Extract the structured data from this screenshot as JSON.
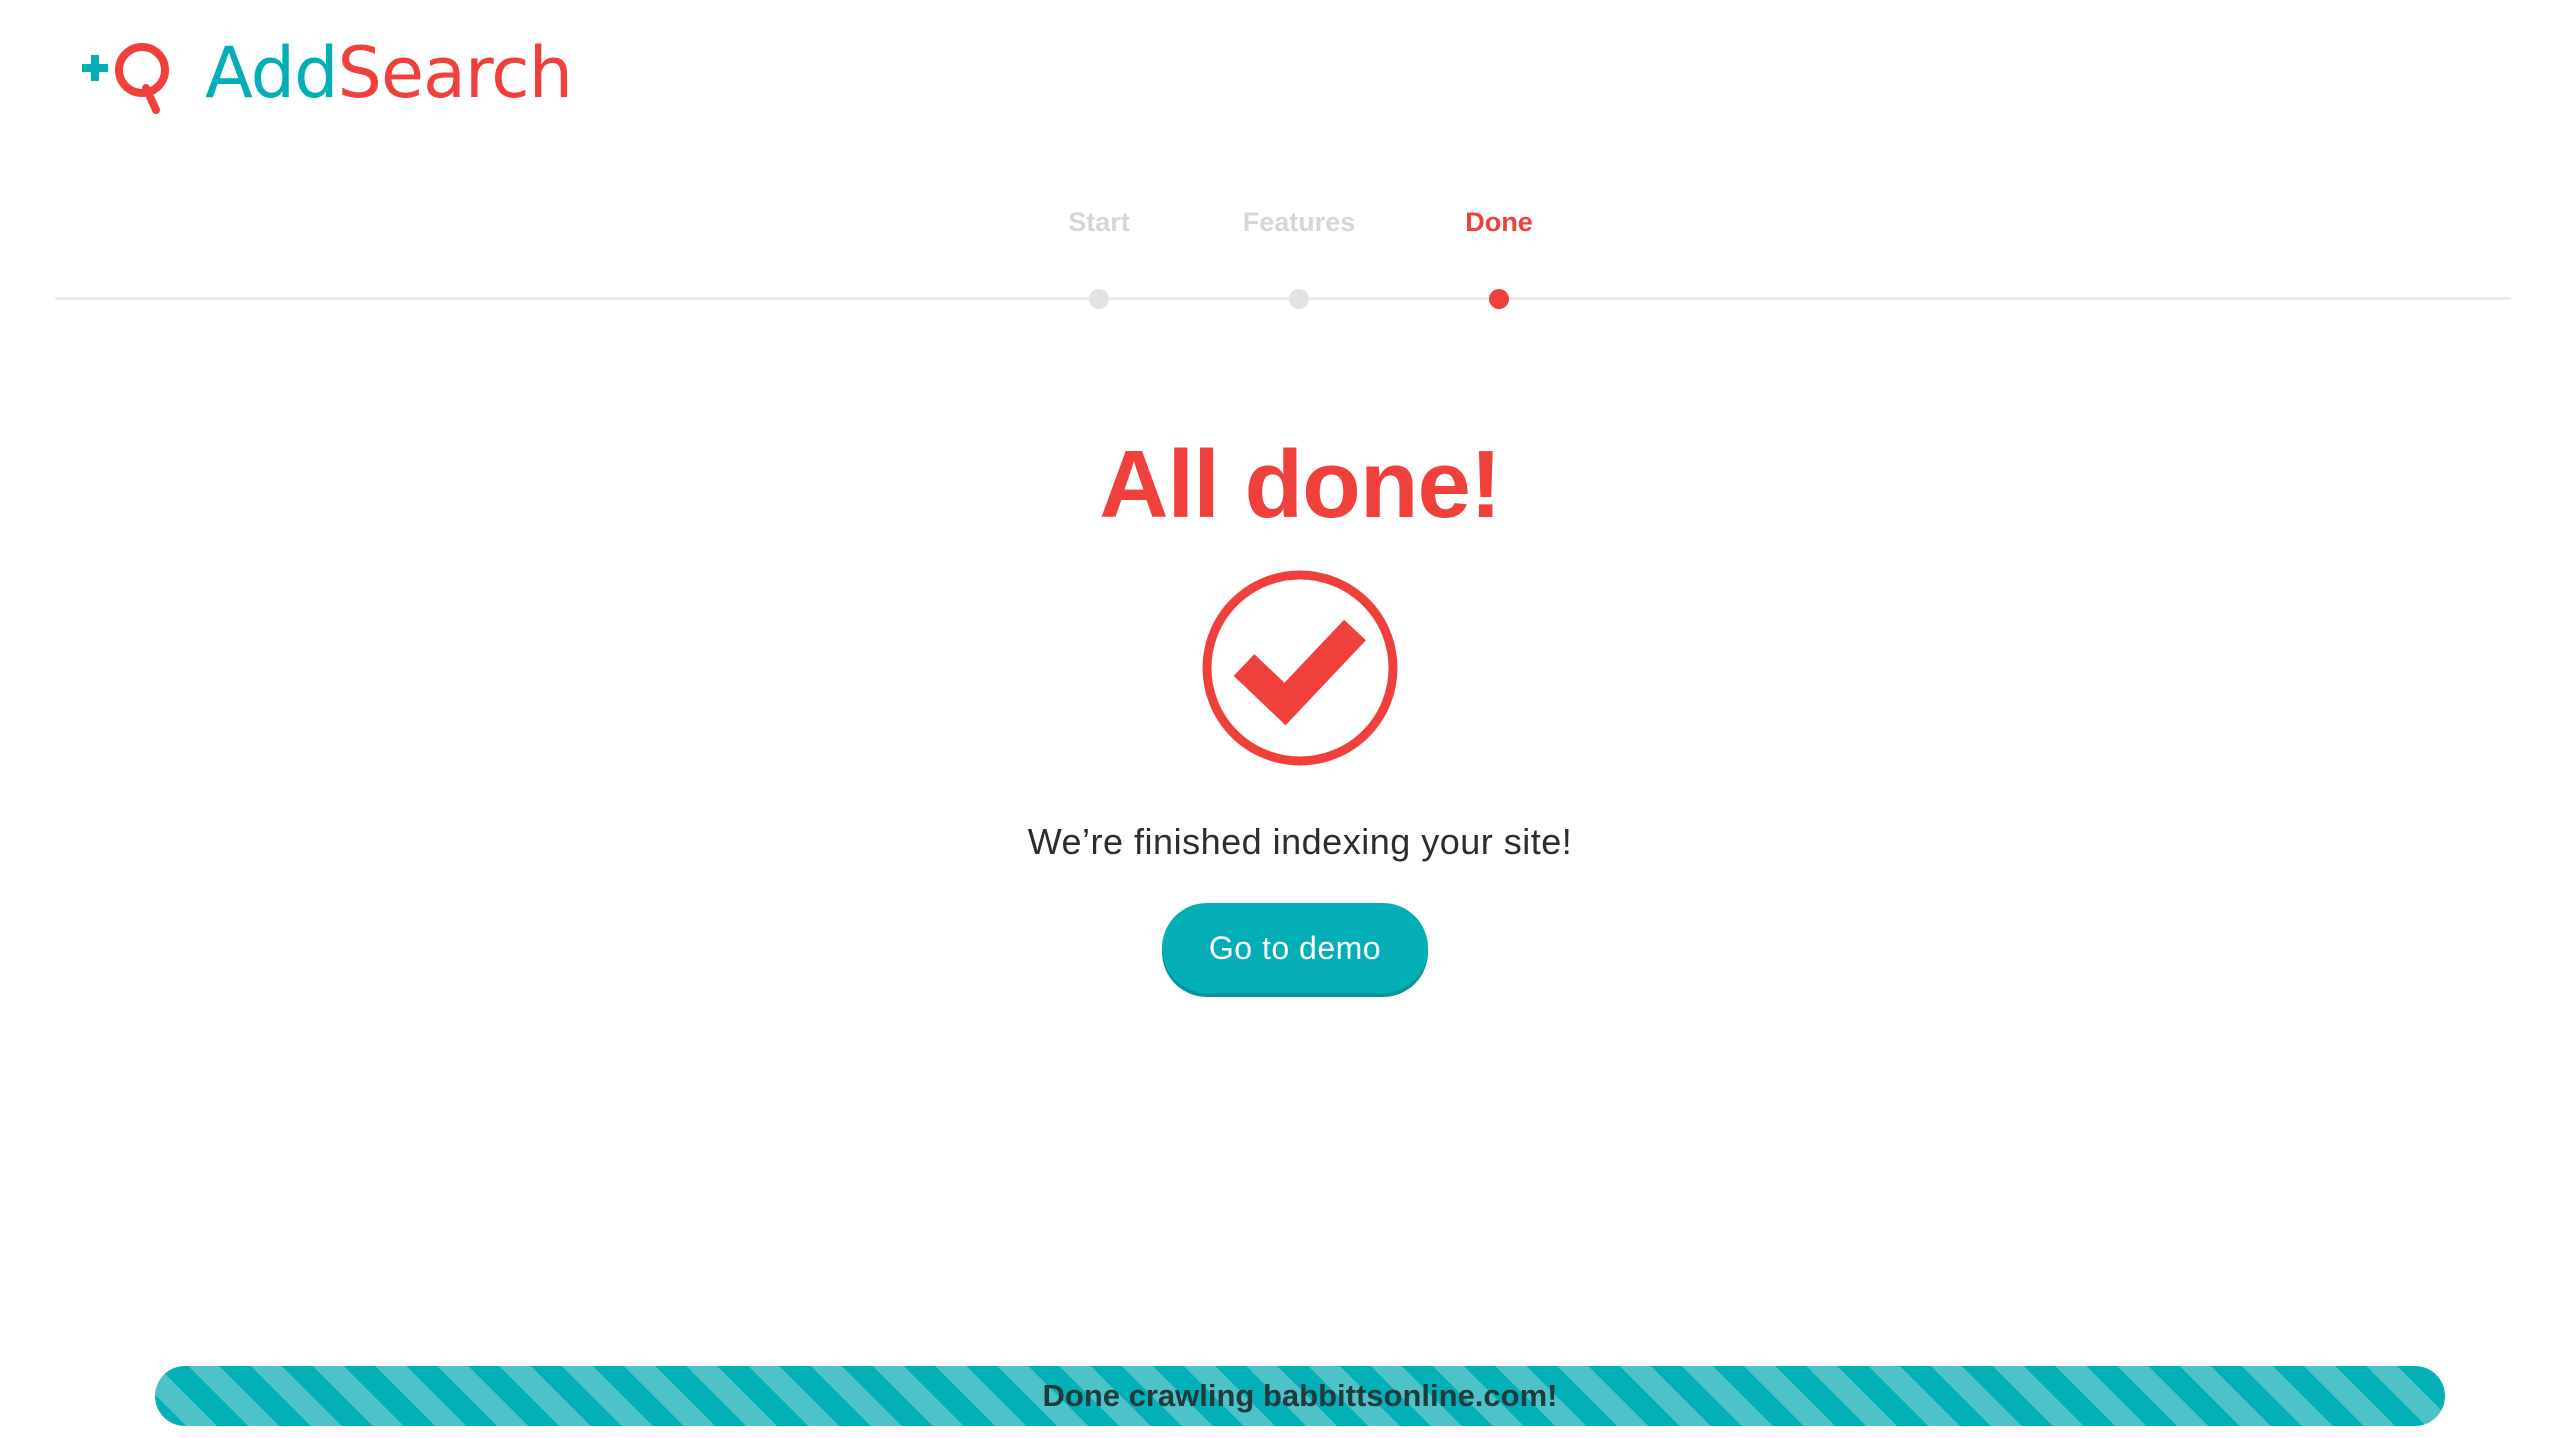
{
  "brand": {
    "name_part1": "Add",
    "name_part2": "Search",
    "logo_icon": "plus-q-logo",
    "color_teal": "#04aeb7",
    "color_red": "#f0403c"
  },
  "stepper": {
    "steps": [
      {
        "label": "Start",
        "state": "completed"
      },
      {
        "label": "Features",
        "state": "completed"
      },
      {
        "label": "Done",
        "state": "active"
      }
    ],
    "active_index": 2
  },
  "main": {
    "title": "All done!",
    "status_icon": "check-circle-icon",
    "message": "We’re finished indexing your site!",
    "demo_button_label": "Go to demo"
  },
  "progress": {
    "text": "Done crawling babbittsonline.com!",
    "percent": 100,
    "style": "striped-teal"
  }
}
